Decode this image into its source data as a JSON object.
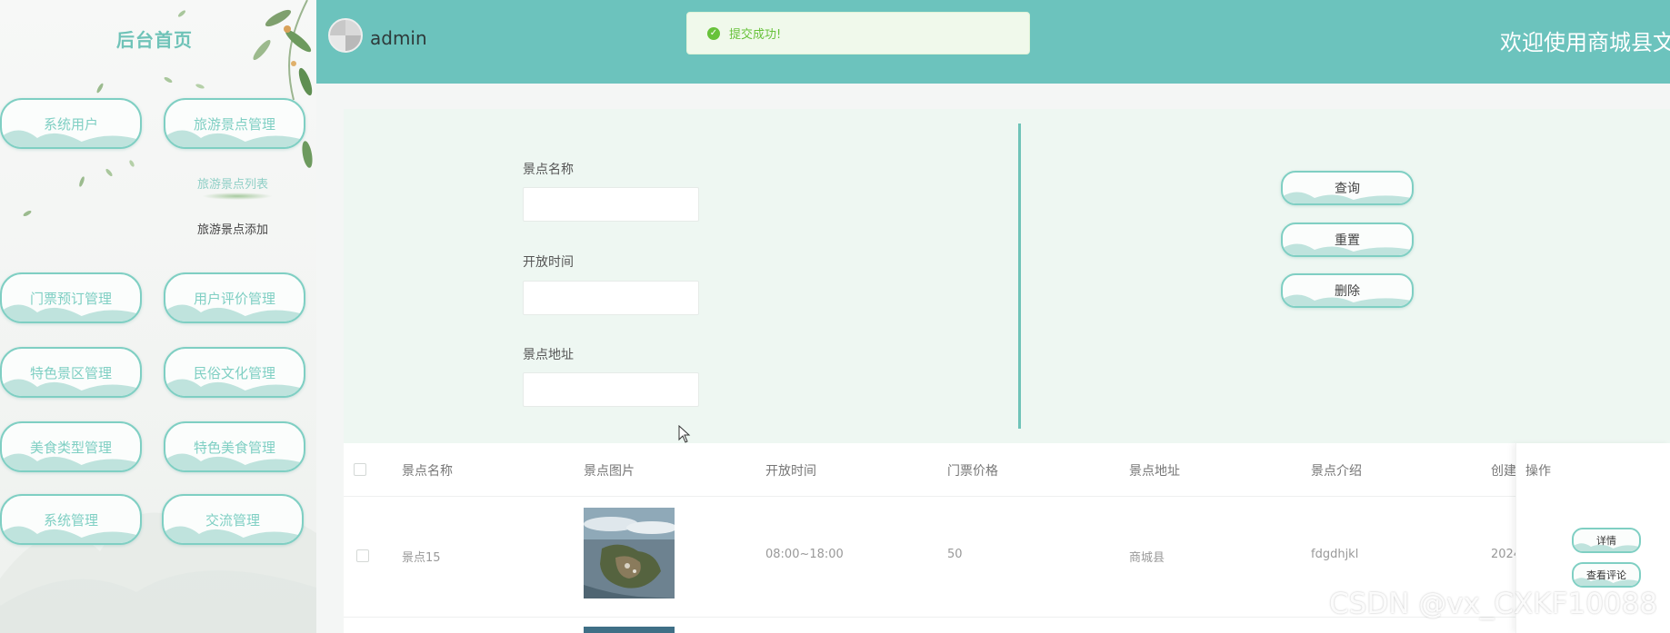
{
  "sidebar": {
    "title": "后台首页",
    "menu": [
      {
        "label": "系统用户"
      },
      {
        "label": "旅游景点管理"
      },
      {
        "label": "门票预订管理"
      },
      {
        "label": "用户评价管理"
      },
      {
        "label": "特色景区管理"
      },
      {
        "label": "民俗文化管理"
      },
      {
        "label": "美食类型管理"
      },
      {
        "label": "特色美食管理"
      },
      {
        "label": "系统管理"
      },
      {
        "label": "交流管理"
      }
    ],
    "submenu": [
      {
        "label": "旅游景点列表",
        "active": true
      },
      {
        "label": "旅游景点添加",
        "active": false
      }
    ]
  },
  "header": {
    "username": "admin",
    "welcome": "欢迎使用商城县文",
    "toast": "提交成功!"
  },
  "search": {
    "fields": [
      {
        "label": "景点名称",
        "value": ""
      },
      {
        "label": "开放时间",
        "value": ""
      },
      {
        "label": "景点地址",
        "value": ""
      }
    ],
    "buttons": {
      "query": "查询",
      "reset": "重置",
      "delete": "删除"
    }
  },
  "table": {
    "columns": [
      "景点名称",
      "景点图片",
      "开放时间",
      "门票价格",
      "景点地址",
      "景点介绍",
      "创建",
      "操作"
    ],
    "rows": [
      {
        "name": "景点15",
        "open_time": "08:00~18:00",
        "price": "50",
        "address": "商城县",
        "intro": "fdgdhjkl",
        "created": "2024",
        "actions": {
          "detail": "详情",
          "reviews": "查看评论"
        }
      }
    ]
  },
  "watermark": "CSDN @vx_CXKF10088",
  "colors": {
    "accent": "#6cc3bd",
    "success": "#67c23a",
    "border": "#7fcfc3"
  }
}
